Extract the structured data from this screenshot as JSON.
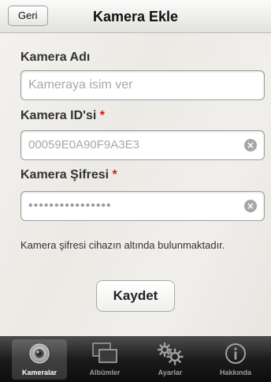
{
  "navbar": {
    "back_label": "Geri",
    "title": "Kamera Ekle"
  },
  "form": {
    "name_label": "Kamera Adı",
    "name_placeholder": "Kameraya isim ver",
    "id_label": "Kamera ID'si",
    "id_value": "00059E0A90F9A3E3",
    "password_label": "Kamera Şifresi",
    "password_value": "••••••••••••••••",
    "required_mark": "*",
    "hint": "Kamera şifresi cihazın altında bulunmaktadır.",
    "save_label": "Kaydet",
    "clear_glyph": "×"
  },
  "tabbar": {
    "tabs": [
      {
        "label": "Kameralar",
        "icon": "camera-lens-icon",
        "active": true
      },
      {
        "label": "Albümler",
        "icon": "albums-icon",
        "active": false
      },
      {
        "label": "Ayarlar",
        "icon": "gears-icon",
        "active": false
      },
      {
        "label": "Hakkında",
        "icon": "info-icon",
        "active": false
      }
    ]
  }
}
